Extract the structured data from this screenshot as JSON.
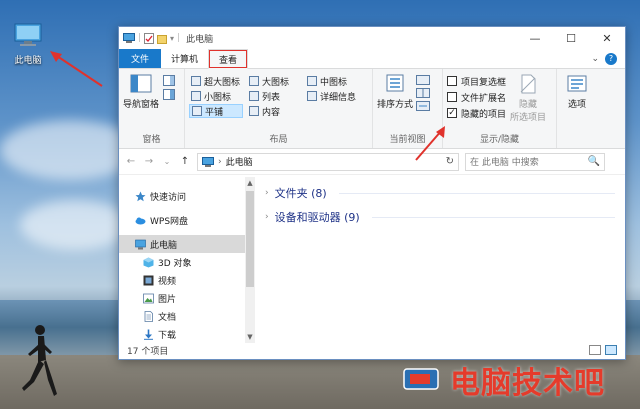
{
  "desktop": {
    "icon_label": "此电脑",
    "watermark": "电脑技术吧"
  },
  "window": {
    "title": "此电脑",
    "controls": {
      "minimize": "—",
      "maximize": "☐",
      "close": "✕"
    }
  },
  "tabs": [
    {
      "label": "文件"
    },
    {
      "label": "计算机"
    },
    {
      "label": "查看"
    }
  ],
  "tab_right": {
    "expand": "⌄",
    "help": "?"
  },
  "ribbon": {
    "pane_group": {
      "name": "窗格",
      "nav_pane": "导航窗格"
    },
    "layout_group": {
      "name": "布局",
      "items": [
        "超大图标",
        "大图标",
        "中图标",
        "小图标",
        "列表",
        "详细信息",
        "平铺",
        "内容"
      ]
    },
    "current_view_group": {
      "name": "当前视图",
      "sort_by": "排序方式"
    },
    "show_hide_group": {
      "name": "显示/隐藏",
      "item_checkboxes": "项目复选框",
      "file_extensions": "文件扩展名",
      "hidden_items": "隐藏的项目",
      "hide_selected_line1": "隐藏",
      "hide_selected_line2": "所选项目"
    },
    "options": "选项"
  },
  "address": {
    "back": "←",
    "forward": "→",
    "recent": "⌄",
    "up": "↑",
    "path": "此电脑",
    "refresh": "↻",
    "search_placeholder": "在 此电脑 中搜索",
    "search_icon": "🔍"
  },
  "nav_pane": [
    {
      "label": "快速访问",
      "icon": "star-icon"
    },
    {
      "label": "WPS网盘",
      "icon": "cloud-icon"
    },
    {
      "label": "此电脑",
      "icon": "computer-icon",
      "selected": true
    },
    {
      "label": "3D 对象",
      "icon": "cube-icon"
    },
    {
      "label": "视频",
      "icon": "video-icon"
    },
    {
      "label": "图片",
      "icon": "picture-icon"
    },
    {
      "label": "文档",
      "icon": "document-icon"
    },
    {
      "label": "下载",
      "icon": "download-icon"
    }
  ],
  "content": {
    "groups": [
      {
        "label": "文件夹 (8)"
      },
      {
        "label": "设备和驱动器 (9)"
      }
    ]
  },
  "status": {
    "count": "17 个项目"
  },
  "colors": {
    "accent": "#1979ca",
    "highlight_red": "#e0322c",
    "selected_bg": "#cce8ff"
  }
}
